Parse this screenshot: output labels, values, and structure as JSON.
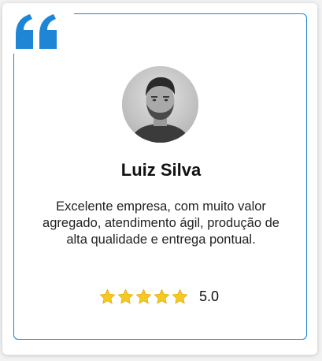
{
  "testimonial": {
    "name": "Luiz Silva",
    "text": "Excelente empresa, com muito valor agregado, atendimento ágil, produção de alta qualidade e entrega pontual.",
    "rating": 5,
    "rating_label": "5.0",
    "max_rating": 5
  },
  "icons": {
    "quote": "quote-icon",
    "avatar": "avatar",
    "star": "star-icon"
  },
  "colors": {
    "accent": "#1f86d6",
    "star": "#f6c824",
    "text": "#222222"
  }
}
